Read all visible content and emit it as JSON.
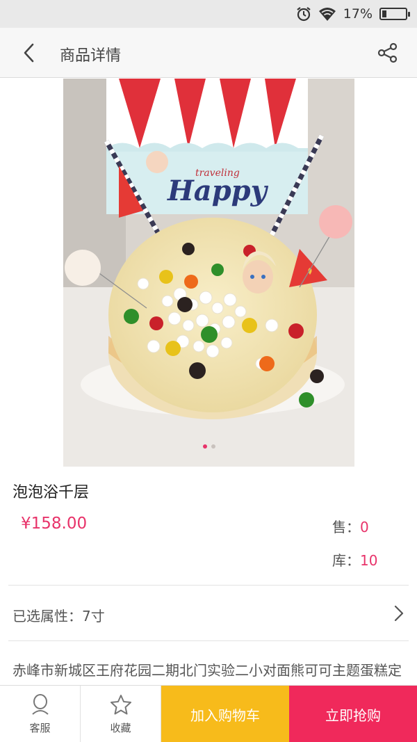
{
  "status_bar": {
    "battery_percent": "17%",
    "icons": [
      "alarm-icon",
      "wifi-icon",
      "battery-icon"
    ]
  },
  "header": {
    "title": "商品详情",
    "back_icon": "chevron-left-icon",
    "share_icon": "share-icon"
  },
  "carousel": {
    "image_description_icon": "product-photo",
    "photo_text": "Happy",
    "photo_subtext": "traveling",
    "page_count": 2,
    "active_index": 0
  },
  "product": {
    "name": "泡泡浴千层",
    "price": "¥158.00",
    "sold_label": "售：",
    "sold_value": "0",
    "stock_label": "库：",
    "stock_value": "10"
  },
  "attribute": {
    "text": "已选属性：7寸"
  },
  "shop": {
    "address": "赤峰市新城区王府花园二期北门实验二小对面熊可可主题蛋糕定制"
  },
  "bottom_bar": {
    "service_label": "客服",
    "favorite_label": "收藏",
    "cart_label": "加入购物车",
    "buy_label": "立即抢购"
  },
  "colors": {
    "accent": "#e8336a",
    "cart_button": "#f7bb1b",
    "buy_button": "#f0295b"
  }
}
